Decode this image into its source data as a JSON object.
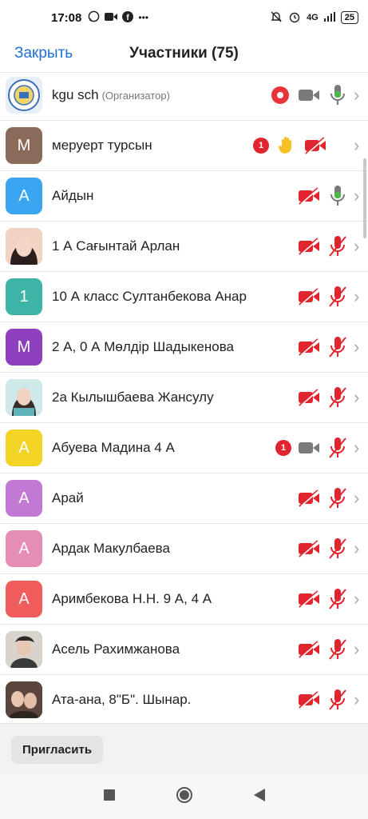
{
  "status": {
    "time": "17:08",
    "net": "4G",
    "battery": "25"
  },
  "header": {
    "close_label": "Закрыть",
    "title": "Участники (75)"
  },
  "participants": [
    {
      "name": "kgu sch",
      "role": "(Организатор)",
      "avatar_letter": "",
      "avatar_type": "logo",
      "avatar_color": "#e8eef6"
    },
    {
      "name": "меруерт турсын",
      "avatar_letter": "M",
      "avatar_color": "#8a6a58",
      "badge": "1"
    },
    {
      "name": "Айдын",
      "avatar_letter": "A",
      "avatar_color": "#3aa6f2"
    },
    {
      "name": "1 А Сағынтай Арлан",
      "avatar_letter": "",
      "avatar_type": "photo",
      "avatar_color": "#b88e79"
    },
    {
      "name": "10 А класс Султанбекова Анар",
      "avatar_letter": "1",
      "avatar_color": "#3db5a6"
    },
    {
      "name": "2 А, 0 А Мөлдір Шадыкенова",
      "avatar_letter": "M",
      "avatar_color": "#8e3fbd"
    },
    {
      "name": "2а Кылышбаева Жансулу",
      "avatar_letter": "",
      "avatar_type": "photo",
      "avatar_color": "#7fc6c9"
    },
    {
      "name": "Абуева Мадина 4 А",
      "avatar_letter": "A",
      "avatar_color": "#f3d325",
      "badge": "1"
    },
    {
      "name": "Арай",
      "avatar_letter": "A",
      "avatar_color": "#c279d3"
    },
    {
      "name": "Ардак Макулбаева",
      "avatar_letter": "A",
      "avatar_color": "#e58db4"
    },
    {
      "name": "Аримбекова Н.Н. 9 А, 4 А",
      "avatar_letter": "A",
      "avatar_color": "#f05c5c"
    },
    {
      "name": "Асель Рахимжанова",
      "avatar_letter": "",
      "avatar_type": "photo",
      "avatar_color": "#8b8b8b"
    },
    {
      "name": "Ата-ана, 8\"Б\".   Шынар.",
      "avatar_letter": "",
      "avatar_type": "photo",
      "avatar_color": "#6d5649"
    }
  ],
  "footer": {
    "invite_label": "Пригласить"
  },
  "colors": {
    "accent": "#1e6fd9",
    "muted_red": "#e0252f",
    "mic_green": "#4db848"
  }
}
